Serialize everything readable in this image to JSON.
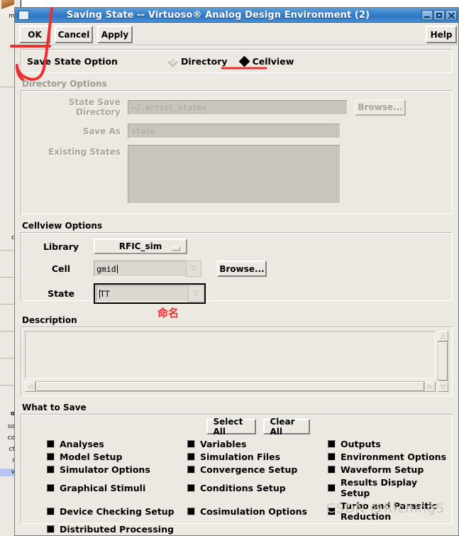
{
  "window": {
    "title": "Saving State -- Virtuoso® Analog Design Environment (2)",
    "menu_box_icon": "window-menu-icon",
    "minimize_label": "–",
    "maximize_label": "□",
    "close_label": "×"
  },
  "toolbar": {
    "ok_label": "OK",
    "cancel_label": "Cancel",
    "apply_label": "Apply",
    "help_label": "Help"
  },
  "save_state_option": {
    "label": "Save State Option",
    "options": [
      {
        "label": "Directory",
        "selected": false
      },
      {
        "label": "Cellview",
        "selected": true
      }
    ]
  },
  "directory_options": {
    "group_label": "Directory Options",
    "enabled": false,
    "state_save_directory": {
      "label": "State Save Directory",
      "value": "~/.artist_states",
      "browse_label": "Browse..."
    },
    "save_as": {
      "label": "Save As",
      "value": "state"
    },
    "existing_states": {
      "label": "Existing States",
      "items": []
    }
  },
  "cellview_options": {
    "group_label": "Cellview Options",
    "library": {
      "label": "Library",
      "value": "RFIC_sim"
    },
    "cell": {
      "label": "Cell",
      "value": "gmid",
      "browse_label": "Browse..."
    },
    "state": {
      "label": "State",
      "value": "TT",
      "focused": true
    }
  },
  "description": {
    "group_label": "Description",
    "value": ""
  },
  "what_to_save": {
    "group_label": "What to Save",
    "select_all_label": "Select All",
    "clear_all_label": "Clear All",
    "items": [
      {
        "label": "Analyses",
        "checked": true
      },
      {
        "label": "Variables",
        "checked": true
      },
      {
        "label": "Outputs",
        "checked": true
      },
      {
        "label": "Model Setup",
        "checked": true
      },
      {
        "label": "Simulation Files",
        "checked": true
      },
      {
        "label": "Environment Options",
        "checked": true
      },
      {
        "label": "Simulator Options",
        "checked": true
      },
      {
        "label": "Convergence Setup",
        "checked": true
      },
      {
        "label": "Waveform Setup",
        "checked": true
      },
      {
        "label": "Graphical Stimuli",
        "checked": true
      },
      {
        "label": "Conditions Setup",
        "checked": true
      },
      {
        "label": "Results Display Setup",
        "checked": true
      },
      {
        "label": "Device Checking Setup",
        "checked": true
      },
      {
        "label": "Cosimulation Options",
        "checked": true
      },
      {
        "label": "Turbo and Parasitic Reduction",
        "checked": true
      },
      {
        "label": "Distributed Processing",
        "checked": true
      },
      {
        "label": "",
        "checked": false
      },
      {
        "label": "",
        "checked": false
      }
    ]
  },
  "annotations": {
    "color": "#ee2f2f",
    "chinese_note": "命名"
  },
  "watermark": {
    "text": "CSDN @Riching5"
  },
  "background_window": {
    "rows": [
      "m",
      "",
      "",
      "",
      "c",
      "",
      "",
      "",
      "",
      "",
      "o",
      "so",
      "co",
      "ct",
      "r",
      "v"
    ]
  }
}
